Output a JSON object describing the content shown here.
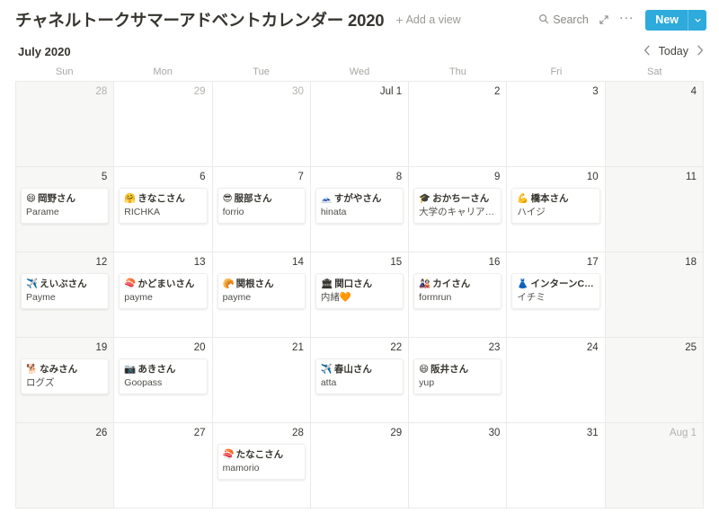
{
  "header": {
    "title": "チャネルトークサマーアドベントカレンダー 2020",
    "add_view_label": "Add a view",
    "add_view_icon": "plus-icon",
    "search_label": "Search",
    "search_icon": "search-icon",
    "expand_icon": "expand-arrows-icon",
    "more_icon": "ellipsis-icon",
    "new_label": "New",
    "new_caret_icon": "chevron-down-icon",
    "accent_color": "#2eaadc"
  },
  "monthbar": {
    "month_label": "July 2020",
    "prev_icon": "chevron-left-icon",
    "today_label": "Today",
    "next_icon": "chevron-right-icon"
  },
  "weekdays": [
    "Sun",
    "Mon",
    "Tue",
    "Wed",
    "Thu",
    "Fri",
    "Sat"
  ],
  "calendar": {
    "cells": [
      {
        "day": "28",
        "muted": true,
        "weekend": true,
        "events": []
      },
      {
        "day": "29",
        "muted": true,
        "weekend": false,
        "events": []
      },
      {
        "day": "30",
        "muted": true,
        "weekend": false,
        "events": []
      },
      {
        "day": "Jul 1",
        "muted": false,
        "weekend": false,
        "events": []
      },
      {
        "day": "2",
        "muted": false,
        "weekend": false,
        "events": []
      },
      {
        "day": "3",
        "muted": false,
        "weekend": false,
        "events": []
      },
      {
        "day": "4",
        "muted": false,
        "weekend": true,
        "events": []
      },
      {
        "day": "5",
        "muted": false,
        "weekend": true,
        "events": [
          {
            "emoji": "😄",
            "emoji_name": "grinning-face-emoji",
            "title": "岡野さん",
            "subtitle": "Parame"
          }
        ]
      },
      {
        "day": "6",
        "muted": false,
        "weekend": false,
        "events": [
          {
            "emoji": "🤗",
            "emoji_name": "hugging-face-emoji",
            "title": "きなこさん",
            "subtitle": "RICHKA"
          }
        ]
      },
      {
        "day": "7",
        "muted": false,
        "weekend": false,
        "events": [
          {
            "emoji": "😎",
            "emoji_name": "sunglasses-face-emoji",
            "title": "服部さん",
            "subtitle": "forrio"
          }
        ]
      },
      {
        "day": "8",
        "muted": false,
        "weekend": false,
        "events": [
          {
            "emoji": "🗻",
            "emoji_name": "mount-fuji-emoji",
            "title": "すがやさん",
            "subtitle": "hinata"
          }
        ]
      },
      {
        "day": "9",
        "muted": false,
        "weekend": false,
        "events": [
          {
            "emoji": "🎓",
            "emoji_name": "graduation-cap-emoji",
            "title": "おかちーさん",
            "subtitle": "大学のキャリアカウ…"
          }
        ]
      },
      {
        "day": "10",
        "muted": false,
        "weekend": false,
        "events": [
          {
            "emoji": "💪",
            "emoji_name": "flexed-biceps-emoji",
            "title": "橋本さん",
            "subtitle": "ハイジ"
          }
        ]
      },
      {
        "day": "11",
        "muted": false,
        "weekend": true,
        "events": []
      },
      {
        "day": "12",
        "muted": false,
        "weekend": true,
        "events": [
          {
            "emoji": "✈️",
            "emoji_name": "airplane-emoji",
            "title": "えいぶさん",
            "subtitle": "Payme"
          }
        ]
      },
      {
        "day": "13",
        "muted": false,
        "weekend": false,
        "events": [
          {
            "emoji": "🍣",
            "emoji_name": "sushi-emoji",
            "title": "かどまいさん",
            "subtitle": "payme"
          }
        ]
      },
      {
        "day": "14",
        "muted": false,
        "weekend": false,
        "events": [
          {
            "emoji": "🥐",
            "emoji_name": "croissant-emoji",
            "title": "関根さん",
            "subtitle": "payme"
          }
        ]
      },
      {
        "day": "15",
        "muted": false,
        "weekend": false,
        "events": [
          {
            "emoji": "🏛",
            "emoji_name": "classical-building-emoji",
            "title": "関口さん",
            "subtitle": "内緒🧡"
          }
        ]
      },
      {
        "day": "16",
        "muted": false,
        "weekend": false,
        "events": [
          {
            "emoji": "🎎",
            "emoji_name": "japanese-dolls-emoji",
            "title": "カイさん",
            "subtitle": "formrun"
          }
        ]
      },
      {
        "day": "17",
        "muted": false,
        "weekend": false,
        "events": [
          {
            "emoji": "👗",
            "emoji_name": "dress-emoji",
            "title": "インターンCEO…",
            "subtitle": "イチミ"
          }
        ]
      },
      {
        "day": "18",
        "muted": false,
        "weekend": true,
        "events": []
      },
      {
        "day": "19",
        "muted": false,
        "weekend": true,
        "events": [
          {
            "emoji": "🐕",
            "emoji_name": "dog-emoji",
            "title": "なみさん",
            "subtitle": "ログズ"
          }
        ]
      },
      {
        "day": "20",
        "muted": false,
        "weekend": false,
        "events": [
          {
            "emoji": "📷",
            "emoji_name": "camera-emoji",
            "title": "あきさん",
            "subtitle": "Goopass"
          }
        ]
      },
      {
        "day": "21",
        "muted": false,
        "weekend": false,
        "events": []
      },
      {
        "day": "22",
        "muted": false,
        "weekend": false,
        "events": [
          {
            "emoji": "✈️",
            "emoji_name": "airplane-emoji",
            "title": "春山さん",
            "subtitle": "atta"
          }
        ]
      },
      {
        "day": "23",
        "muted": false,
        "weekend": false,
        "events": [
          {
            "emoji": "😄",
            "emoji_name": "grinning-face-emoji",
            "title": "阪井さん",
            "subtitle": "yup"
          }
        ]
      },
      {
        "day": "24",
        "muted": false,
        "weekend": false,
        "events": []
      },
      {
        "day": "25",
        "muted": false,
        "weekend": true,
        "events": []
      },
      {
        "day": "26",
        "muted": false,
        "weekend": true,
        "events": []
      },
      {
        "day": "27",
        "muted": false,
        "weekend": false,
        "events": []
      },
      {
        "day": "28",
        "muted": false,
        "weekend": false,
        "events": [
          {
            "emoji": "🍣",
            "emoji_name": "sushi-emoji",
            "title": "たなこさん",
            "subtitle": "mamorio"
          }
        ]
      },
      {
        "day": "29",
        "muted": false,
        "weekend": false,
        "events": []
      },
      {
        "day": "30",
        "muted": false,
        "weekend": false,
        "events": []
      },
      {
        "day": "31",
        "muted": false,
        "weekend": false,
        "events": []
      },
      {
        "day": "Aug 1",
        "muted": true,
        "weekend": true,
        "events": []
      }
    ]
  }
}
